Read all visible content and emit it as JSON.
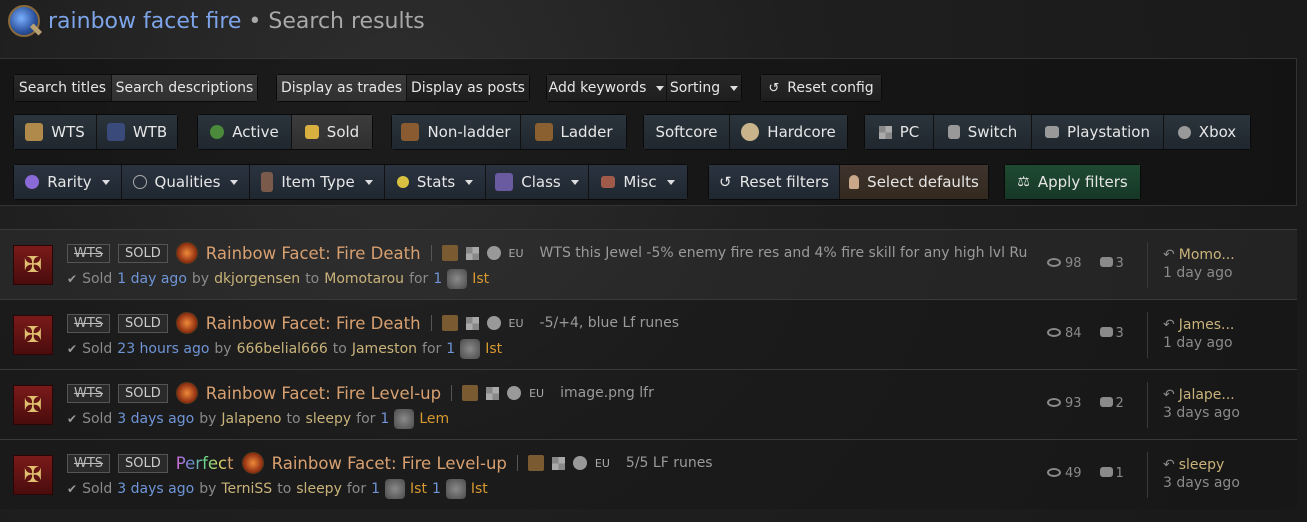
{
  "header": {
    "title_link": "rainbow facet fire",
    "title_rest": " • Search results"
  },
  "toolbar": {
    "row1": {
      "search_titles": "Search titles",
      "search_descriptions": "Search descriptions",
      "display_trades": "Display as trades",
      "display_posts": "Display as posts",
      "add_keywords": "Add keywords",
      "sorting": "Sorting",
      "reset_config": "Reset config"
    },
    "row2": {
      "wts": "WTS",
      "wtb": "WTB",
      "active": "Active",
      "sold": "Sold",
      "nonladder": "Non-ladder",
      "ladder": "Ladder",
      "softcore": "Softcore",
      "hardcore": "Hardcore",
      "pc": "PC",
      "switch": "Switch",
      "playstation": "Playstation",
      "xbox": "Xbox"
    },
    "row3": {
      "rarity": "Rarity",
      "qualities": "Qualities",
      "item_type": "Item Type",
      "stats": "Stats",
      "class": "Class",
      "misc": "Misc",
      "reset_filters": "Reset filters",
      "select_defaults": "Select defaults",
      "apply_filters": "Apply filters"
    }
  },
  "results": [
    {
      "tag_wts": "WTS",
      "tag_sold": "SOLD",
      "prefix": "",
      "name": "Rainbow Facet: Fire Death",
      "region": "EU",
      "desc": "WTS this Jewel -5% enemy fire res and 4% fire skill for any high lvl Ru",
      "sold": "Sold",
      "ago": "1 day ago",
      "by": "by",
      "seller": "dkjorgensen",
      "to": "to",
      "buyer": "Momotarou",
      "for": "for",
      "price": [
        {
          "qty": "1",
          "rune": "Ist"
        }
      ],
      "views": "98",
      "comments": "3",
      "last_user": "Momo...",
      "last_time": "1 day ago"
    },
    {
      "tag_wts": "WTS",
      "tag_sold": "SOLD",
      "prefix": "",
      "name": "Rainbow Facet: Fire Death",
      "region": "EU",
      "desc": "-5/+4, blue Lf runes",
      "sold": "Sold",
      "ago": "23 hours ago",
      "by": "by",
      "seller": "666belial666",
      "to": "to",
      "buyer": "Jameston",
      "for": "for",
      "price": [
        {
          "qty": "1",
          "rune": "Ist"
        }
      ],
      "views": "84",
      "comments": "3",
      "last_user": "James...",
      "last_time": "1 day ago"
    },
    {
      "tag_wts": "WTS",
      "tag_sold": "SOLD",
      "prefix": "",
      "name": "Rainbow Facet: Fire Level-up",
      "region": "EU",
      "desc": "image.png lfr",
      "sold": "Sold",
      "ago": "3 days ago",
      "by": "by",
      "seller": "Jalapeno",
      "to": "to",
      "buyer": "sleepy",
      "for": "for",
      "price": [
        {
          "qty": "1",
          "rune": "Lem"
        }
      ],
      "views": "93",
      "comments": "2",
      "last_user": "Jalape...",
      "last_time": "3 days ago"
    },
    {
      "tag_wts": "WTS",
      "tag_sold": "SOLD",
      "prefix": "Perfect",
      "name": "Rainbow Facet: Fire Level-up",
      "region": "EU",
      "desc": "5/5 LF runes",
      "sold": "Sold",
      "ago": "3 days ago",
      "by": "by",
      "seller": "TerniSS",
      "to": "to",
      "buyer": "sleepy",
      "for": "for",
      "price": [
        {
          "qty": "1",
          "rune": "Ist"
        },
        {
          "qty": "1",
          "rune": "Ist"
        }
      ],
      "views": "49",
      "comments": "1",
      "last_user": "sleepy",
      "last_time": "3 days ago"
    }
  ]
}
